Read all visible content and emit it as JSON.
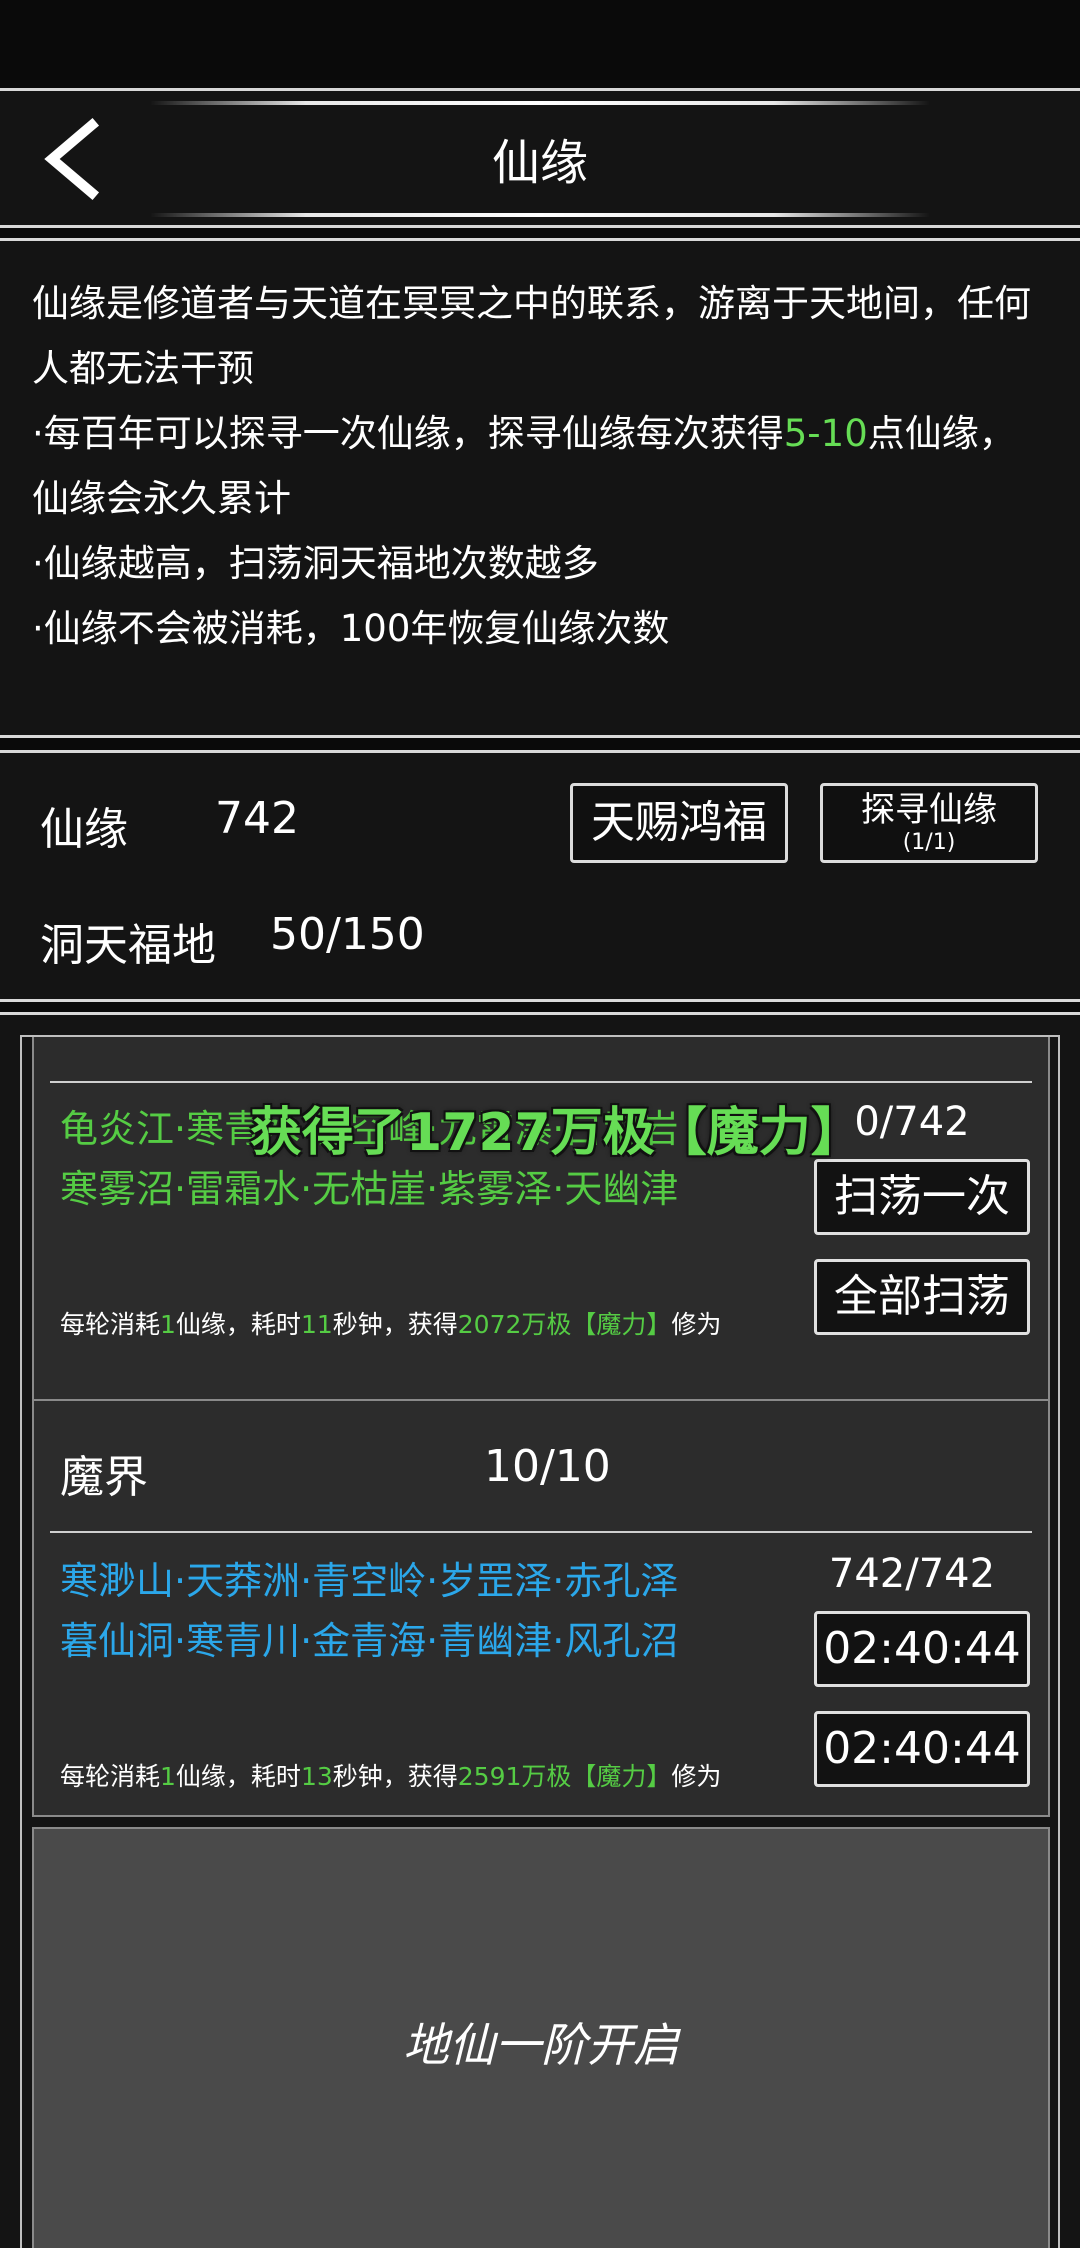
{
  "header": {
    "title": "仙缘"
  },
  "description": {
    "line1": "仙缘是修道者与天道在冥冥之中的联系，游离于天地间，任何人都无法干预",
    "line2_pre": "·每百年可以探寻一次仙缘，探寻仙缘每次获得",
    "line2_highlight": "5-10",
    "line2_post": "点仙缘，仙缘会永久累计",
    "line3": "·仙缘越高，扫荡洞天福地次数越多",
    "line4": "·仙缘不会被消耗，100年恢复仙缘次数"
  },
  "stats": {
    "xianyuan_label": "仙缘",
    "xianyuan_value": "742",
    "dongtian_label": "洞天福地",
    "dongtian_value": "50/150",
    "blessing_button": "天赐鸿福",
    "seek_button": "探寻仙缘",
    "seek_count": "(1/1)"
  },
  "toast": "获得了1727万极【魔力】",
  "realms": [
    {
      "places_line1": "龟炎江·寒青水·青空峰·九霄瀑·白雷岩",
      "places_line2": "寒雾沼·雷霜水·无枯崖·紫雾泽·天幽津",
      "count": "0/742",
      "btn1": "扫荡一次",
      "btn2": "全部扫荡",
      "cost_a": "每轮消耗",
      "cost_n1": "1",
      "cost_b": "仙缘，耗时",
      "cost_n2": "11",
      "cost_c": "秒钟，获得",
      "cost_n3": "2072万极",
      "cost_n4": "【魔力】",
      "cost_d": "修为"
    },
    {
      "name": "魔界",
      "progress": "10/10",
      "places_line1": "寒渺山·天莽洲·青空岭·岁罡泽·赤孔泽",
      "places_line2": "暮仙洞·寒青川·金青海·青幽津·风孔沼",
      "count": "742/742",
      "btn1": "02:40:44",
      "btn2": "02:40:44",
      "cost_a": "每轮消耗",
      "cost_n1": "1",
      "cost_b": "仙缘，耗时",
      "cost_n2": "13",
      "cost_c": "秒钟，获得",
      "cost_n3": "2591万极",
      "cost_n4": "【魔力】",
      "cost_d": "修为"
    }
  ],
  "locked": {
    "text": "地仙一阶开启"
  },
  "colors": {
    "green": "#66dd55",
    "blue": "#2ba7ea",
    "panel": "#141414",
    "card": "#2c2c2c",
    "locked": "#4a4a4a"
  }
}
